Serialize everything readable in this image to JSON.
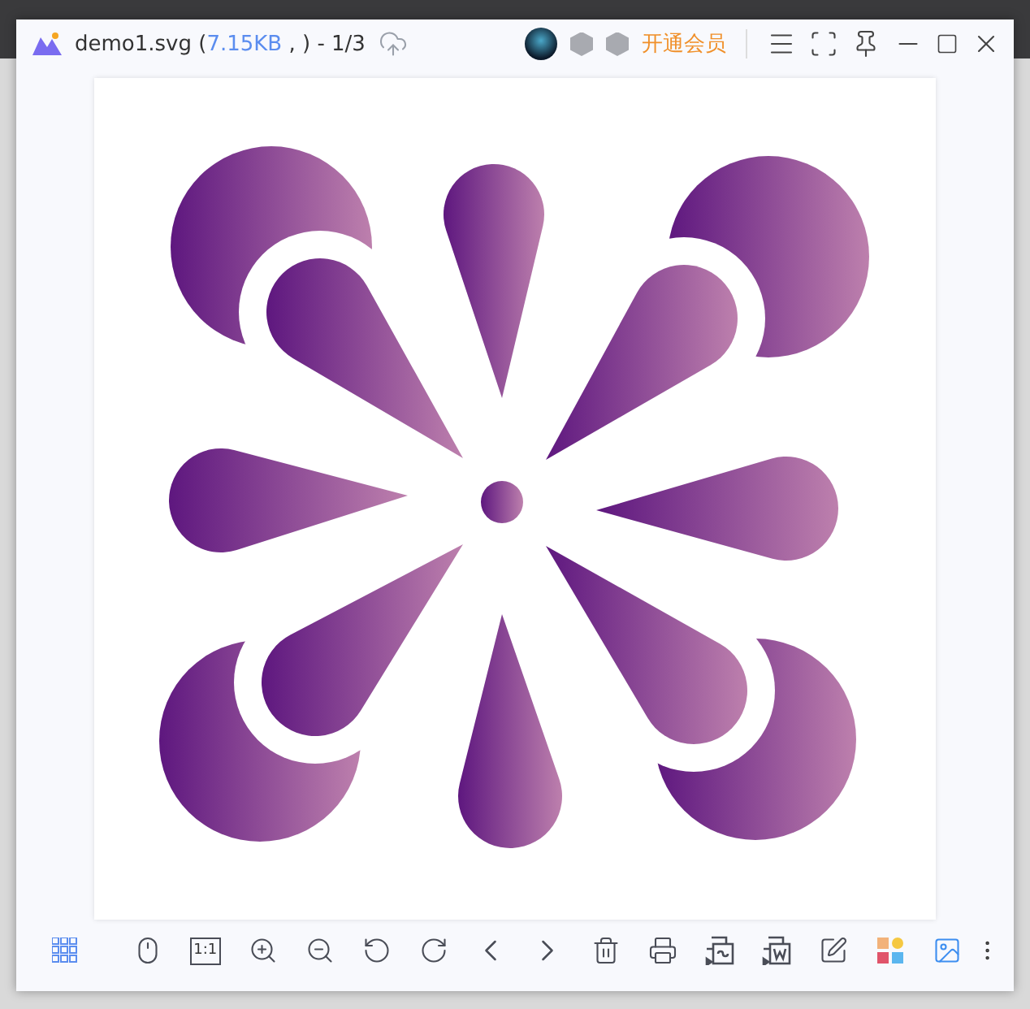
{
  "window": {
    "file_name": "demo1.svg (",
    "file_size": "7.15KB",
    "file_suffix": " , ) - 1/3",
    "vip_label": "开通会员"
  },
  "toolbar": {
    "actual_size_label": "1:1"
  }
}
